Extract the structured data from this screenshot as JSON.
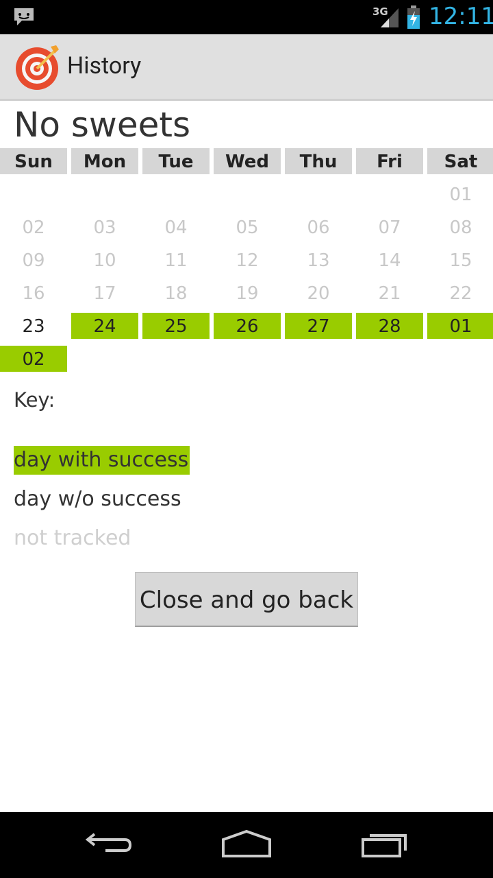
{
  "status_bar": {
    "network": "3G",
    "time": "12:11"
  },
  "action_bar": {
    "title": "History"
  },
  "goal_title": "No sweets",
  "calendar": {
    "weekdays": [
      "Sun",
      "Mon",
      "Tue",
      "Wed",
      "Thu",
      "Fri",
      "Sat"
    ],
    "weeks": [
      [
        null,
        null,
        null,
        null,
        null,
        null,
        {
          "label": "01",
          "status": "not_tracked"
        }
      ],
      [
        {
          "label": "02",
          "status": "not_tracked"
        },
        {
          "label": "03",
          "status": "not_tracked"
        },
        {
          "label": "04",
          "status": "not_tracked"
        },
        {
          "label": "05",
          "status": "not_tracked"
        },
        {
          "label": "06",
          "status": "not_tracked"
        },
        {
          "label": "07",
          "status": "not_tracked"
        },
        {
          "label": "08",
          "status": "not_tracked"
        }
      ],
      [
        {
          "label": "09",
          "status": "not_tracked"
        },
        {
          "label": "10",
          "status": "not_tracked"
        },
        {
          "label": "11",
          "status": "not_tracked"
        },
        {
          "label": "12",
          "status": "not_tracked"
        },
        {
          "label": "13",
          "status": "not_tracked"
        },
        {
          "label": "14",
          "status": "not_tracked"
        },
        {
          "label": "15",
          "status": "not_tracked"
        }
      ],
      [
        {
          "label": "16",
          "status": "not_tracked"
        },
        {
          "label": "17",
          "status": "not_tracked"
        },
        {
          "label": "18",
          "status": "not_tracked"
        },
        {
          "label": "19",
          "status": "not_tracked"
        },
        {
          "label": "20",
          "status": "not_tracked"
        },
        {
          "label": "21",
          "status": "not_tracked"
        },
        {
          "label": "22",
          "status": "not_tracked"
        }
      ],
      [
        {
          "label": "23",
          "status": "failure"
        },
        {
          "label": "24",
          "status": "success"
        },
        {
          "label": "25",
          "status": "success"
        },
        {
          "label": "26",
          "status": "success"
        },
        {
          "label": "27",
          "status": "success"
        },
        {
          "label": "28",
          "status": "success"
        },
        {
          "label": "01",
          "status": "success"
        }
      ],
      [
        {
          "label": "02",
          "status": "success"
        },
        null,
        null,
        null,
        null,
        null,
        null
      ]
    ]
  },
  "key": {
    "label": "Key:",
    "success": "day with success",
    "failure": "day w/o success",
    "not_tracked": "not tracked"
  },
  "close_button": "Close and go back",
  "colors": {
    "success": "#99cc00",
    "not_tracked": "#c8c8c8",
    "header": "#d6d6d6",
    "clock": "#33b5e5"
  }
}
